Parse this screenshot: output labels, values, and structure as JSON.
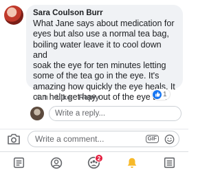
{
  "comment": {
    "author": "Sara Coulson Burr",
    "lines": [
      "What Jane says about medication for",
      "eyes but also use a normal tea bag,",
      "boiling water leave it to cool down and",
      "soak the eye for ten minutes letting",
      "some of the tea go in the eye. It's",
      "amazing how quickly the eye heals. It",
      "can help get hay out of the eye to x"
    ],
    "time": "4 m",
    "like_label": "Like",
    "reply_label": "Reply",
    "reaction_count": "1"
  },
  "reply_input": {
    "placeholder": "Write a reply..."
  },
  "comment_input": {
    "placeholder": "Write a comment...",
    "gif_label": "GIF"
  },
  "nav": {
    "items": [
      "news-feed",
      "profile",
      "groups",
      "notifications",
      "menu"
    ],
    "groups_badge": "2",
    "active_color": "#1877f2",
    "notification_color": "#f7b928"
  }
}
